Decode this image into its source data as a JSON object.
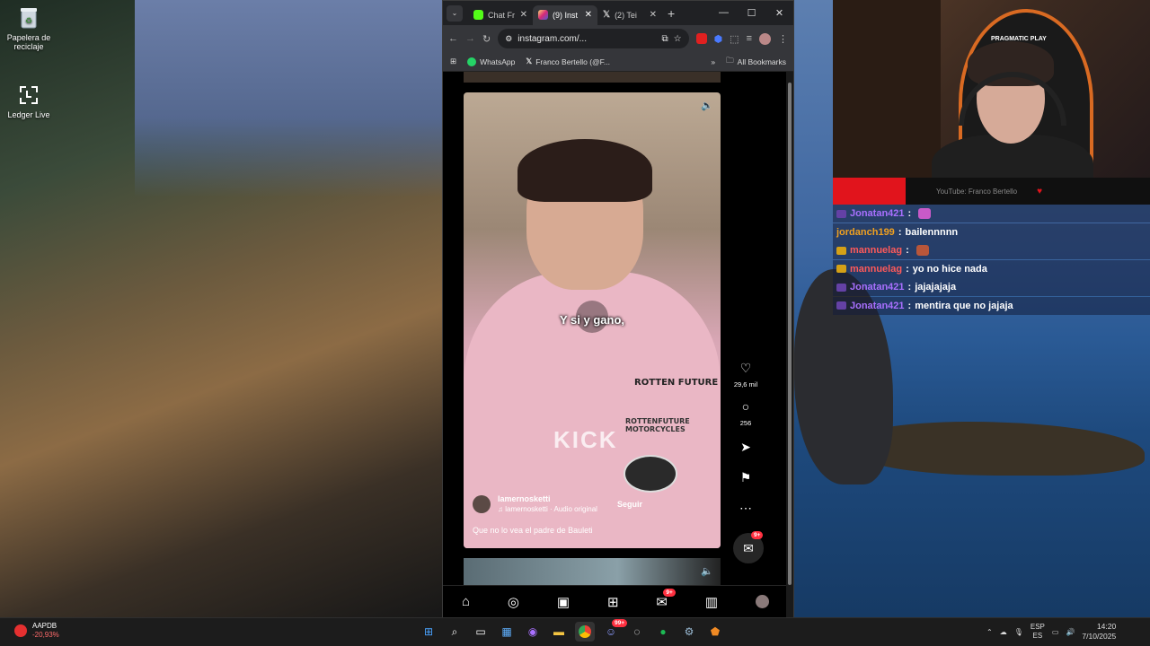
{
  "desktop": {
    "icons": [
      {
        "label": "Papelera de reciclaje",
        "icon": "recycle-bin-icon"
      },
      {
        "label": "Ledger Live",
        "icon": "ledger-icon"
      }
    ]
  },
  "browser": {
    "tabs": [
      {
        "label": "Chat Fr",
        "icon": "kick-favicon",
        "color": "#53fc18"
      },
      {
        "label": "(9) Inst",
        "icon": "instagram-favicon",
        "color": "#e1306c"
      },
      {
        "label": "(2) Tei",
        "icon": "x-favicon",
        "color": "#ffffff"
      }
    ],
    "address": "instagram.com/...",
    "bookmarks": [
      {
        "label": "WhatsApp",
        "icon": "whatsapp-icon"
      },
      {
        "label": "Franco Bertello (@F...",
        "icon": "x-icon"
      }
    ],
    "all_bookmarks": "All Bookmarks"
  },
  "reel": {
    "subtitle": "Y si y gano,",
    "watermark": "KICK",
    "patch_text": "ROTTEN FUTURE",
    "patch_text2": "ROTTENFUTURE MOTORCYCLES",
    "username": "lamernosketti",
    "audio": "lamernosketti · Audio original",
    "follow": "Seguir",
    "caption": "Que no lo vea el padre de Bauleti",
    "likes": "29,6 mil",
    "comments": "256",
    "messages_badge": "9+"
  },
  "ig_nav": {
    "dm_badge": "9+"
  },
  "webcam": {
    "overlay_text": "YouTube: Franco Bertello",
    "brand": "PRAGMATIC PLAY"
  },
  "chat": [
    {
      "user": "Jonatan421",
      "sep": ":",
      "message": "",
      "user_color": "#a970ff",
      "badge_color": "#6441a5",
      "emote": true
    },
    {
      "user": "jordanch199",
      "sep": ":",
      "message": "bailennnnn",
      "user_color": "#f0a020",
      "badge_color": "",
      "emote": false
    },
    {
      "user": "mannuelag",
      "sep": ":",
      "message": "",
      "user_color": "#ff5a5a",
      "badge_color": "#d4a017",
      "emote": true
    },
    {
      "user": "mannuelag",
      "sep": ":",
      "message": "yo no hice nada",
      "user_color": "#ff5a5a",
      "badge_color": "#d4a017",
      "emote": false
    },
    {
      "user": "Jonatan421",
      "sep": ":",
      "message": "jajajajaja",
      "user_color": "#a970ff",
      "badge_color": "#6441a5",
      "emote": false
    },
    {
      "user": "Jonatan421",
      "sep": ":",
      "message": "mentira que no jajaja",
      "user_color": "#a970ff",
      "badge_color": "#6441a5",
      "emote": false
    }
  ],
  "taskbar": {
    "stock_name": "AAPDB",
    "stock_change": "-20,93%",
    "lang_top": "ESP",
    "lang_bottom": "ES",
    "time": "14:20",
    "date": "7/10/2025",
    "discord_badge": "99+"
  }
}
